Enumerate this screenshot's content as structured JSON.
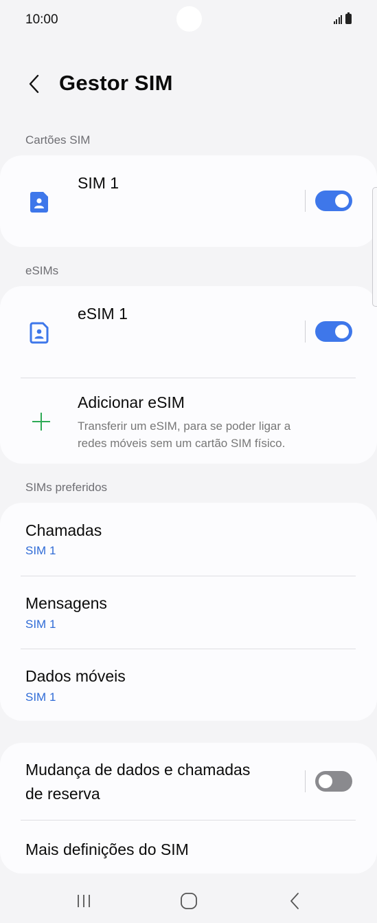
{
  "status_bar": {
    "time": "10:00"
  },
  "header": {
    "title": "Gestor SIM"
  },
  "sections": {
    "sim_cards": "Cartões SIM",
    "esims": "eSIMs",
    "preferred": "SIMs preferidos"
  },
  "sim_cards": [
    {
      "name": "SIM 1",
      "enabled": true
    }
  ],
  "esims": [
    {
      "name": "eSIM 1",
      "enabled": true
    }
  ],
  "add_esim": {
    "title": "Adicionar eSIM",
    "description_line1": "Transferir um eSIM, para se poder ligar a",
    "description_line2": "redes móveis sem um cartão SIM físico."
  },
  "preferred": [
    {
      "title": "Chamadas",
      "value": "SIM 1"
    },
    {
      "title": "Mensagens",
      "value": "SIM 1"
    },
    {
      "title": "Dados móveis",
      "value": "SIM 1"
    }
  ],
  "backup": {
    "title_line1": "Mudança de dados e chamadas",
    "title_line2": "de reserva",
    "enabled": false
  },
  "more_settings": "Mais definições do SIM",
  "colors": {
    "accent": "#3e77ea",
    "link": "#2f6bd6",
    "plus": "#2eaa55",
    "background": "#f4f4f6",
    "card": "#fcfcfe"
  },
  "icons": [
    "back-arrow-icon",
    "sim-card-icon",
    "esim-card-icon",
    "plus-icon",
    "recents-icon",
    "home-icon",
    "nav-back-icon"
  ]
}
